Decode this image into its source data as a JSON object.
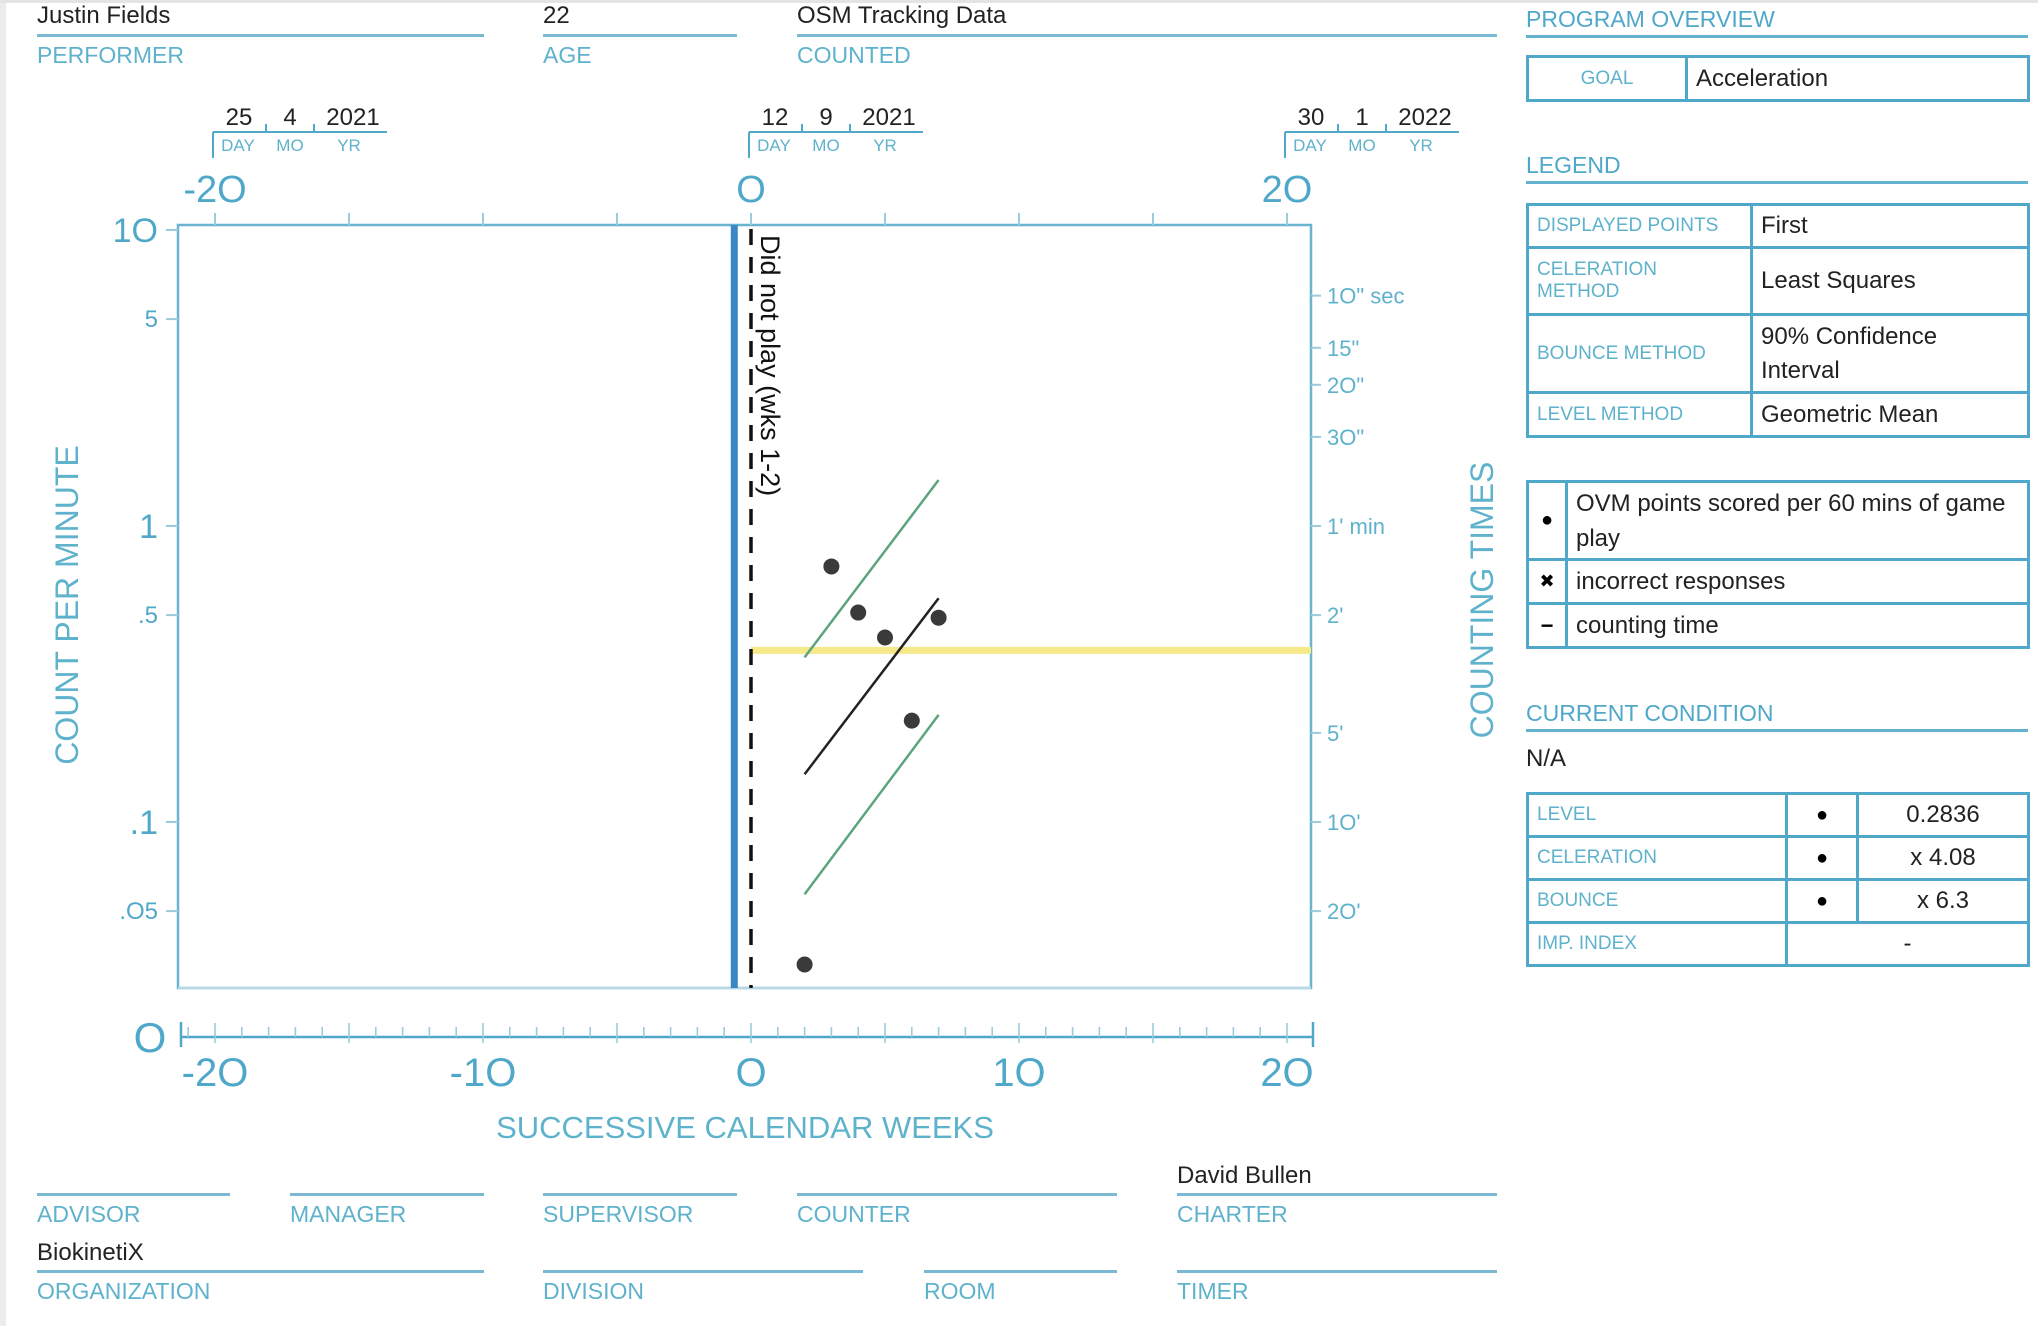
{
  "header": {
    "performer": {
      "value": "Justin Fields",
      "label": "PERFORMER"
    },
    "age": {
      "value": "22",
      "label": "AGE"
    },
    "counted": {
      "value": "OSM Tracking Data",
      "label": "COUNTED"
    }
  },
  "dates": [
    {
      "day": "25",
      "mo": "4",
      "yr": "2021",
      "at_week": -20
    },
    {
      "day": "12",
      "mo": "9",
      "yr": "2021",
      "at_week": 0
    },
    {
      "day": "30",
      "mo": "1",
      "yr": "2022",
      "at_week": 20
    }
  ],
  "date_labels": {
    "day": "DAY",
    "mo": "MO",
    "yr": "YR"
  },
  "program_overview": {
    "title": "PROGRAM OVERVIEW",
    "goal_label": "GOAL",
    "goal_value": "Acceleration"
  },
  "legend": {
    "title": "LEGEND",
    "rows": [
      {
        "key": "DISPLAYED POINTS",
        "value": "First"
      },
      {
        "key": "CELERATION METHOD",
        "value": "Least Squares"
      },
      {
        "key": "BOUNCE METHOD",
        "value": "90% Confidence Interval"
      },
      {
        "key": "LEVEL METHOD",
        "value": "Geometric Mean"
      }
    ],
    "symbols": [
      {
        "icon": "dot-icon",
        "glyph": "●",
        "label": "OVM points scored per 60 mins of game play"
      },
      {
        "icon": "x-icon",
        "glyph": "✖",
        "label": "incorrect responses"
      },
      {
        "icon": "dash-icon",
        "glyph": "−",
        "label": "counting time"
      }
    ]
  },
  "current_condition": {
    "title": "CURRENT CONDITION",
    "value": "N/A",
    "rows": [
      {
        "key": "LEVEL",
        "symbol": "●",
        "value": "0.2836"
      },
      {
        "key": "CELERATION",
        "symbol": "●",
        "value": "x 4.08"
      },
      {
        "key": "BOUNCE",
        "symbol": "●",
        "value": "x 6.3"
      },
      {
        "key": "IMP. INDEX",
        "symbol": "",
        "value": "-"
      }
    ]
  },
  "footer": {
    "advisor": {
      "value": "",
      "label": "ADVISOR"
    },
    "manager": {
      "value": "",
      "label": "MANAGER"
    },
    "supervisor": {
      "value": "",
      "label": "SUPERVISOR"
    },
    "counter": {
      "value": "",
      "label": "COUNTER"
    },
    "charter": {
      "value": "David Bullen",
      "label": "CHARTER"
    },
    "organization": {
      "value": "BiokinetiX",
      "label": "ORGANIZATION"
    },
    "division": {
      "value": "",
      "label": "DIVISION"
    },
    "room": {
      "value": "",
      "label": "ROOM"
    },
    "timer": {
      "value": "",
      "label": "TIMER"
    }
  },
  "colors": {
    "accent": "#4fa8c9",
    "phase_line": "#3a87c8",
    "counting_time": "#f5e98a",
    "celeration": "#222222",
    "bounce": "#5aa57e",
    "point": "#3a3a3a"
  },
  "chart_data": {
    "type": "scatter",
    "title": "",
    "xlabel": "SUCCESSIVE CALENDAR WEEKS",
    "ylabel": "COUNT PER MINUTE",
    "y2label": "COUNTING TIMES",
    "xlim": [
      -21,
      21.5
    ],
    "ylim": [
      0.028,
      10
    ],
    "yscale": "log",
    "x_ticks": [
      -20,
      -10,
      0,
      10,
      20
    ],
    "x_tick_labels": [
      "-2O",
      "-1O",
      "O",
      "1O",
      "2O"
    ],
    "top_tick_labels": [
      "-2O",
      "O",
      "2O"
    ],
    "top_ticks": [
      -20,
      -15,
      -10,
      -5,
      0,
      5,
      10,
      15,
      20
    ],
    "y_ticks": [
      {
        "value": 10,
        "label": "1O"
      },
      {
        "value": 5,
        "label": "5"
      },
      {
        "value": 1,
        "label": "1"
      },
      {
        "value": 0.5,
        "label": ".5"
      },
      {
        "value": 0.1,
        "label": ".1"
      },
      {
        "value": 0.05,
        "label": ".O5"
      }
    ],
    "y_zero_label": "O",
    "y2_ticks": [
      {
        "value": 6,
        "label": "1O\" sec"
      },
      {
        "value": 4,
        "label": "15\""
      },
      {
        "value": 3,
        "label": "2O\""
      },
      {
        "value": 2,
        "label": "3O\""
      },
      {
        "value": 1,
        "label": "1' min"
      },
      {
        "value": 0.5,
        "label": "2'"
      },
      {
        "value": 0.2,
        "label": "5'"
      },
      {
        "value": 0.1,
        "label": "1O'"
      },
      {
        "value": 0.05,
        "label": "2O'"
      }
    ],
    "phase_change": {
      "week": -0.4,
      "label": "",
      "color": "#3a87c8"
    },
    "annotation": {
      "week": 0,
      "text": "Did not play (wks 1-2)",
      "style": "dashed"
    },
    "counting_time": {
      "value": 0.38,
      "from_week": 0,
      "to_week": 21.5
    },
    "series": [
      {
        "name": "OVM points scored per 60 mins of game play",
        "marker": "dot",
        "points": [
          {
            "x": 2,
            "y": 0.033
          },
          {
            "x": 3,
            "y": 0.73
          },
          {
            "x": 4,
            "y": 0.51
          },
          {
            "x": 5,
            "y": 0.42
          },
          {
            "x": 6,
            "y": 0.22
          },
          {
            "x": 7,
            "y": 0.49
          }
        ]
      }
    ],
    "celeration_line": {
      "x": [
        2,
        7
      ],
      "y": [
        0.145,
        0.57
      ]
    },
    "bounce_upper": {
      "x": [
        2,
        7
      ],
      "y": [
        0.36,
        1.43
      ]
    },
    "bounce_lower": {
      "x": [
        2,
        7
      ],
      "y": [
        0.057,
        0.23
      ]
    }
  }
}
